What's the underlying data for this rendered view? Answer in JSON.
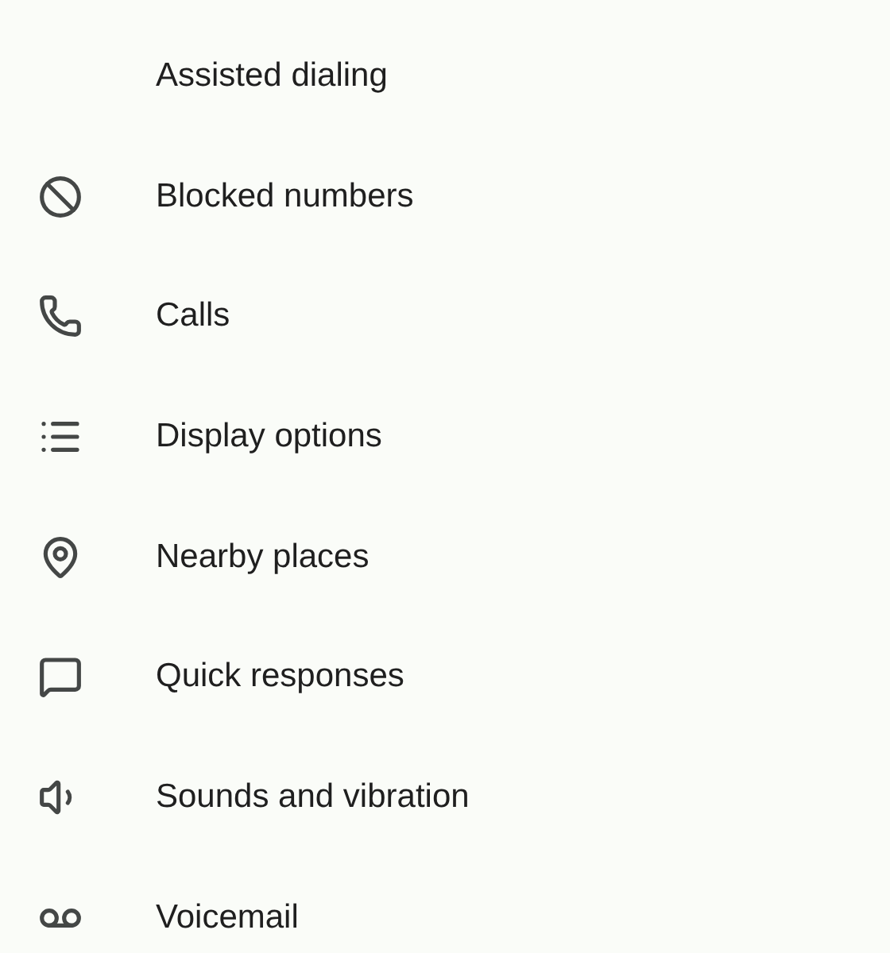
{
  "settings": [
    {
      "label": "Assisted dialing",
      "kind": "none"
    },
    {
      "label": "Blocked numbers",
      "kind": "blocked"
    },
    {
      "label": "Calls",
      "kind": "phone"
    },
    {
      "label": "Display options",
      "kind": "list"
    },
    {
      "label": "Nearby places",
      "kind": "pin"
    },
    {
      "label": "Quick responses",
      "kind": "chat"
    },
    {
      "label": "Sounds and vibration",
      "kind": "volume"
    },
    {
      "label": "Voicemail",
      "kind": "voicemail"
    }
  ]
}
